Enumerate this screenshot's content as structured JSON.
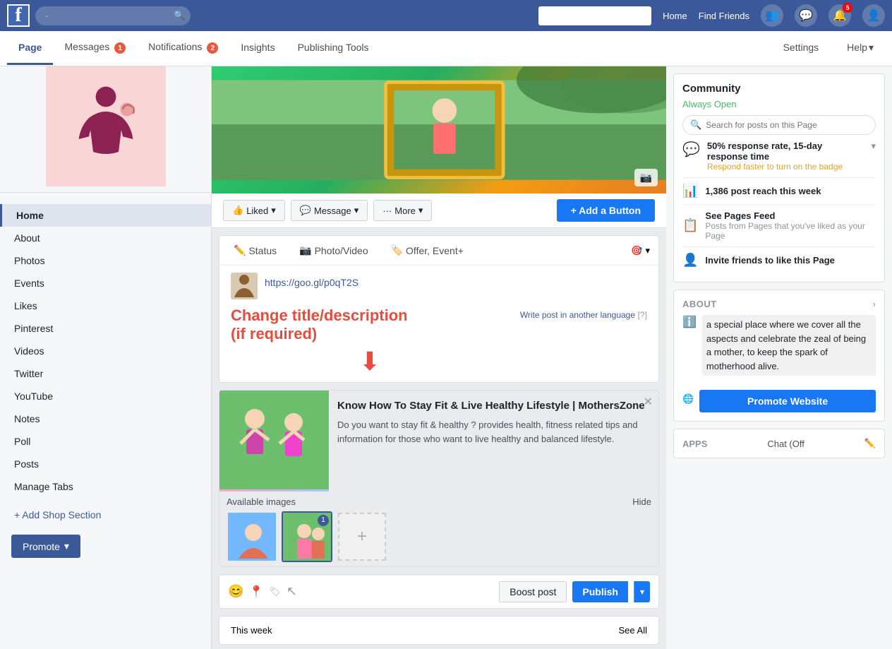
{
  "topnav": {
    "fb_logo": "f",
    "search_placeholder": "·",
    "home_label": "Home",
    "find_friends_label": "Find Friends",
    "notification_count": "5",
    "search_right_placeholder": ""
  },
  "page_tabs": {
    "tab_page": "Page",
    "tab_messages": "Messages",
    "tab_messages_count": "1",
    "tab_notifications": "Notifications",
    "tab_notifications_count": "2",
    "tab_insights": "Insights",
    "tab_publishing_tools": "Publishing Tools",
    "tab_settings": "Settings",
    "tab_help": "Help"
  },
  "sidebar": {
    "nav_items": [
      {
        "label": "Home",
        "active": true
      },
      {
        "label": "About"
      },
      {
        "label": "Photos"
      },
      {
        "label": "Events"
      },
      {
        "label": "Likes"
      },
      {
        "label": "Pinterest"
      },
      {
        "label": "Videos"
      },
      {
        "label": "Twitter"
      },
      {
        "label": "YouTube"
      },
      {
        "label": "Notes"
      },
      {
        "label": "Poll"
      },
      {
        "label": "Posts"
      },
      {
        "label": "Manage Tabs"
      }
    ],
    "add_shop_label": "+ Add Shop Section",
    "promote_label": "Promote"
  },
  "cover": {
    "camera_icon": "📷"
  },
  "action_bar": {
    "liked_label": "Liked",
    "message_label": "Message",
    "more_label": "More",
    "add_button_label": "+ Add a Button"
  },
  "composer": {
    "status_label": "Status",
    "photo_video_label": "Photo/Video",
    "offer_event_label": "Offer, Event+",
    "url_text": "https://goo.gl/p0qT2S",
    "annotation_text": "Change title/description\n(if required)",
    "write_another_lang": "Write post in another language",
    "help_bracket": "[?]"
  },
  "link_preview": {
    "title": "Know How To Stay Fit & Live Healthy Lifestyle | MothersZone",
    "description": "Do you want to stay fit & healthy ? provides health, fitness related tips and information for those who want to live healthy and balanced lifestyle.",
    "close_label": "✕"
  },
  "available_images": {
    "label": "Available images",
    "hide_label": "Hide"
  },
  "composer_footer": {
    "boost_label": "Boost post",
    "publish_label": "Publish"
  },
  "this_week": {
    "label": "This week",
    "see_all_label": "See All"
  },
  "right_sidebar": {
    "community_title": "Community",
    "always_open": "Always Open",
    "search_placeholder": "Search for posts on this Page",
    "response_rate": "50% response rate, 15-day response time",
    "respond_badge": "Respond faster to turn on the badge",
    "post_reach": "1,386 post reach this week",
    "see_pages_feed": "See Pages Feed",
    "pages_feed_sub": "Posts from Pages that you've liked as your Page",
    "invite_friends": "Invite friends to like this Page",
    "about_label": "ABOUT",
    "about_text": "a special place where we cover all the aspects and celebrate the zeal of being a mother, to keep the spark of motherhood alive.",
    "promote_website_label": "Promote Website",
    "apps_label": "APPS",
    "chat_off_label": "Chat (Off"
  }
}
